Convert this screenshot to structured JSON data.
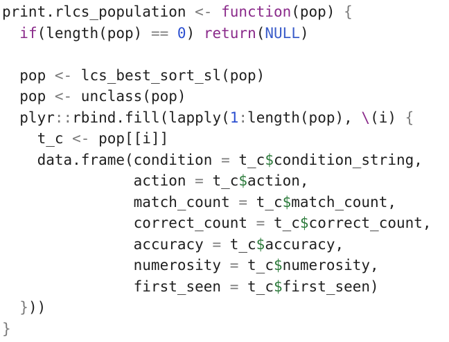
{
  "editor": {
    "language": "R",
    "colors": {
      "default": "#1f1f1f",
      "operator": "#7a7a7a",
      "keyword": "#8a2a8a",
      "number": "#2b4fd0",
      "constant": "#3a5cc9",
      "dollar": "#2b7a3a"
    },
    "lines": [
      [
        {
          "t": "print.rlcs_population",
          "k": "default"
        },
        {
          "t": " <- ",
          "k": "op"
        },
        {
          "t": "function",
          "k": "keyword"
        },
        {
          "t": "(pop) ",
          "k": "default"
        },
        {
          "t": "{",
          "k": "op"
        }
      ],
      [
        {
          "t": "  ",
          "k": "default"
        },
        {
          "t": "if",
          "k": "keyword"
        },
        {
          "t": "(length(pop) ",
          "k": "default"
        },
        {
          "t": "==",
          "k": "op"
        },
        {
          "t": " ",
          "k": "default"
        },
        {
          "t": "0",
          "k": "number"
        },
        {
          "t": ") ",
          "k": "default"
        },
        {
          "t": "return",
          "k": "keyword"
        },
        {
          "t": "(",
          "k": "default"
        },
        {
          "t": "NULL",
          "k": "constant"
        },
        {
          "t": ")",
          "k": "default"
        }
      ],
      [],
      [
        {
          "t": "  pop ",
          "k": "default"
        },
        {
          "t": "<-",
          "k": "op"
        },
        {
          "t": " lcs_best_sort_sl(pop)",
          "k": "default"
        }
      ],
      [
        {
          "t": "  pop ",
          "k": "default"
        },
        {
          "t": "<-",
          "k": "op"
        },
        {
          "t": " unclass(pop)",
          "k": "default"
        }
      ],
      [
        {
          "t": "  plyr",
          "k": "default"
        },
        {
          "t": "::",
          "k": "op"
        },
        {
          "t": "rbind.fill(lapply(",
          "k": "default"
        },
        {
          "t": "1",
          "k": "number"
        },
        {
          "t": ":",
          "k": "op"
        },
        {
          "t": "length(pop), ",
          "k": "default"
        },
        {
          "t": "\\",
          "k": "keyword"
        },
        {
          "t": "(i) ",
          "k": "default"
        },
        {
          "t": "{",
          "k": "op"
        }
      ],
      [
        {
          "t": "    t_c ",
          "k": "default"
        },
        {
          "t": "<-",
          "k": "op"
        },
        {
          "t": " pop[[i]]",
          "k": "default"
        }
      ],
      [
        {
          "t": "    data.frame(condition ",
          "k": "default"
        },
        {
          "t": "=",
          "k": "op"
        },
        {
          "t": " t_c",
          "k": "default"
        },
        {
          "t": "$",
          "k": "dollar"
        },
        {
          "t": "condition_string,",
          "k": "default"
        }
      ],
      [
        {
          "t": "               action ",
          "k": "default"
        },
        {
          "t": "=",
          "k": "op"
        },
        {
          "t": " t_c",
          "k": "default"
        },
        {
          "t": "$",
          "k": "dollar"
        },
        {
          "t": "action,",
          "k": "default"
        }
      ],
      [
        {
          "t": "               match_count ",
          "k": "default"
        },
        {
          "t": "=",
          "k": "op"
        },
        {
          "t": " t_c",
          "k": "default"
        },
        {
          "t": "$",
          "k": "dollar"
        },
        {
          "t": "match_count,",
          "k": "default"
        }
      ],
      [
        {
          "t": "               correct_count ",
          "k": "default"
        },
        {
          "t": "=",
          "k": "op"
        },
        {
          "t": " t_c",
          "k": "default"
        },
        {
          "t": "$",
          "k": "dollar"
        },
        {
          "t": "correct_count,",
          "k": "default"
        }
      ],
      [
        {
          "t": "               accuracy ",
          "k": "default"
        },
        {
          "t": "=",
          "k": "op"
        },
        {
          "t": " t_c",
          "k": "default"
        },
        {
          "t": "$",
          "k": "dollar"
        },
        {
          "t": "accuracy,",
          "k": "default"
        }
      ],
      [
        {
          "t": "               numerosity ",
          "k": "default"
        },
        {
          "t": "=",
          "k": "op"
        },
        {
          "t": " t_c",
          "k": "default"
        },
        {
          "t": "$",
          "k": "dollar"
        },
        {
          "t": "numerosity,",
          "k": "default"
        }
      ],
      [
        {
          "t": "               first_seen ",
          "k": "default"
        },
        {
          "t": "=",
          "k": "op"
        },
        {
          "t": " t_c",
          "k": "default"
        },
        {
          "t": "$",
          "k": "dollar"
        },
        {
          "t": "first_seen)",
          "k": "default"
        }
      ],
      [
        {
          "t": "  ",
          "k": "default"
        },
        {
          "t": "}",
          "k": "op"
        },
        {
          "t": "))",
          "k": "default"
        }
      ],
      [
        {
          "t": "}",
          "k": "op"
        }
      ]
    ]
  }
}
